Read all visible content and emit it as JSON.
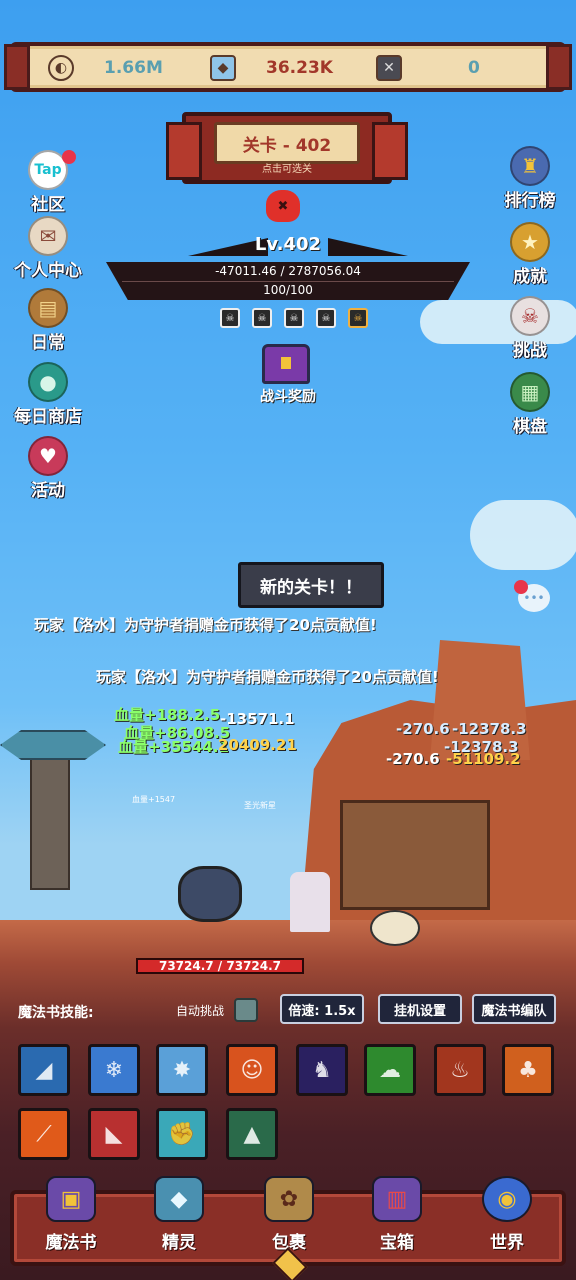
{
  "resources": [
    {
      "icon": "gold-coin-icon",
      "value": "1.66M",
      "color": "#5a9fb0"
    },
    {
      "icon": "crystal-icon",
      "value": "36.23K",
      "color": "#a2372a"
    },
    {
      "icon": "rune-icon",
      "value": "0",
      "color": "#5a9fb0"
    }
  ],
  "stage": {
    "title": "关卡 - 402",
    "hint": "点击可选关"
  },
  "boss": {
    "level": "Lv.402",
    "damage_line": "-47011.46 / 2787056.04",
    "hp_line": "100/100"
  },
  "battle_reward": "战斗奖励",
  "left_menu": [
    {
      "label": "社区",
      "icon": "tap-icon"
    },
    {
      "label": "个人中心",
      "icon": "profile-icon"
    },
    {
      "label": "日常",
      "icon": "daily-icon"
    },
    {
      "label": "每日商店",
      "icon": "shop-icon"
    },
    {
      "label": "活动",
      "icon": "event-icon"
    }
  ],
  "tap_text": "Tap",
  "right_menu": [
    {
      "label": "排行榜",
      "icon": "ranking-icon"
    },
    {
      "label": "成就",
      "icon": "achievement-icon"
    },
    {
      "label": "挑战",
      "icon": "challenge-skull-icon"
    },
    {
      "label": "棋盘",
      "icon": "chessboard-icon"
    }
  ],
  "new_stage_text": "新的关卡！！",
  "notices": [
    "玩家【洛水】为守护者捐赠金币获得了20点贡献值!",
    "玩家【洛水】为守护者捐赠金币获得了20点贡献值!"
  ],
  "damage_numbers": [
    {
      "text": "血量+188.2.5",
      "style": "green"
    },
    {
      "text": "-13571.1",
      "style": "white"
    },
    {
      "text": "血量+86.08.5",
      "style": "green"
    },
    {
      "text": "血量+35544.1",
      "style": "green"
    },
    {
      "text": "20409.21",
      "style": "yellow"
    },
    {
      "text": "-270.6",
      "style": "blue"
    },
    {
      "text": "-12378.3",
      "style": "blue"
    },
    {
      "text": "-12378.3",
      "style": "blue"
    },
    {
      "text": "-270.6",
      "style": "white"
    },
    {
      "text": "-51109.2",
      "style": "yellow"
    }
  ],
  "small_labels": {
    "pet_heal": "血量+1547",
    "skill_name": "圣光新星"
  },
  "hero_hp": "73724.7 / 73724.7",
  "skill_panel": {
    "title": "魔法书技能:",
    "auto_challenge": "自动挑战",
    "speed": "倍速: 1.5x",
    "idle_settings": "挂机设置",
    "book_team": "魔法书编队"
  },
  "skills": [
    {
      "icon": "wind-slash-icon",
      "color": "#2a6ab0"
    },
    {
      "icon": "ice-shards-icon",
      "color": "#3a7ad0"
    },
    {
      "icon": "lightning-burst-icon",
      "color": "#5aa0d8"
    },
    {
      "icon": "fire-spirit-icon",
      "color": "#d8531e"
    },
    {
      "icon": "shadow-figure-icon",
      "color": "#2a2060"
    },
    {
      "icon": "poison-cloud-icon",
      "color": "#2e8a2e"
    },
    {
      "icon": "flame-sword-icon",
      "color": "#a2361e"
    },
    {
      "icon": "fire-golem-icon",
      "color": "#d0601e"
    },
    {
      "icon": "flame-strike-icon",
      "color": "#e05a1a"
    },
    {
      "icon": "blade-slash-icon",
      "color": "#b83030"
    },
    {
      "icon": "ice-fist-icon",
      "color": "#3aa8b8"
    },
    {
      "icon": "wolf-claw-icon",
      "color": "#2a6a4a"
    }
  ],
  "bottom_nav": [
    {
      "label": "魔法书",
      "icon": "spellbook-icon",
      "color": "#6a4aa8"
    },
    {
      "label": "精灵",
      "icon": "spirit-crystal-icon",
      "color": "#4a90b0"
    },
    {
      "label": "包裹",
      "icon": "bag-icon",
      "color": "#b08a4a"
    },
    {
      "label": "宝箱",
      "icon": "chest-icon",
      "color": "#6a4aa8"
    },
    {
      "label": "世界",
      "icon": "world-eye-icon",
      "color": "#3a6ad0"
    }
  ]
}
